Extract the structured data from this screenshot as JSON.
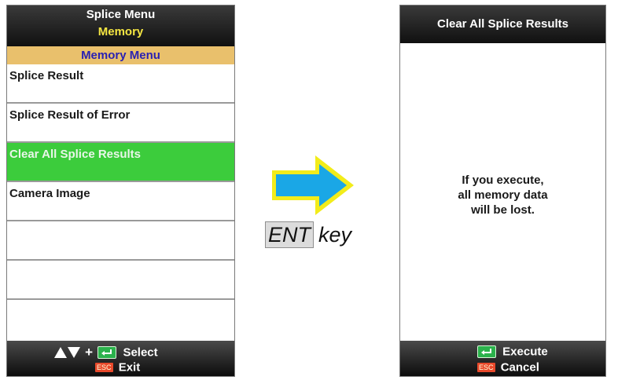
{
  "left_screen": {
    "header_title": "Splice Menu",
    "header_subtitle": "Memory",
    "submenu_title": "Memory Menu",
    "items": [
      {
        "label": "Splice Result"
      },
      {
        "label": "Splice Result of Error"
      },
      {
        "label": "Clear All Splice Results",
        "selected": true
      },
      {
        "label": "Camera Image"
      },
      {
        "label": ""
      },
      {
        "label": ""
      },
      {
        "label": ""
      }
    ],
    "footer": {
      "plus": "+",
      "select_label": "Select",
      "esc_label": "ESC",
      "exit_label": "Exit"
    }
  },
  "transition": {
    "key_label": "ENT",
    "suffix": "key"
  },
  "right_screen": {
    "header_title": "Clear All Splice Results",
    "message_lines": [
      "If you execute,",
      "all memory data",
      "will be lost."
    ],
    "footer": {
      "execute_label": "Execute",
      "esc_label": "ESC",
      "cancel_label": "Cancel"
    }
  },
  "colors": {
    "selected_row": "#3ccc3c",
    "submenu_bar": "#e9c06c",
    "submenu_text": "#2a21b3",
    "subtitle_yellow": "#f5e642",
    "arrow_fill": "#1aa7e6",
    "arrow_border": "#f2ec1a"
  }
}
